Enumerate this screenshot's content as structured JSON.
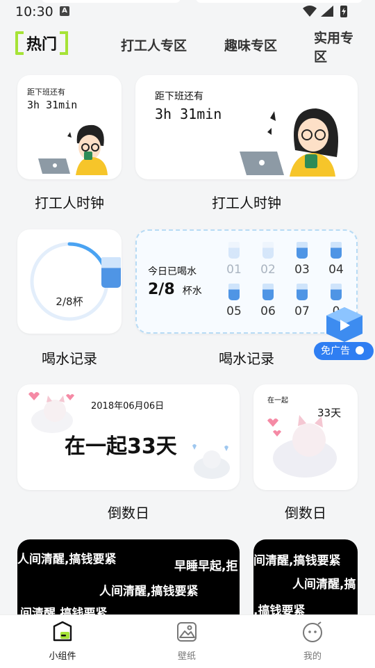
{
  "status": {
    "time": "10:30",
    "notif": "A"
  },
  "tabs": {
    "active": "热门",
    "items": [
      "打工人专区",
      "趣味专区",
      "实用专"
    ],
    "item3_line2": "区"
  },
  "work_clock": {
    "small": {
      "line1": "距下班还有",
      "line2": "3h 31min"
    },
    "large": {
      "line1": "距下班还有",
      "line2": "3h 31min"
    },
    "label1": "打工人时钟",
    "label2": "打工人时钟"
  },
  "water": {
    "small": {
      "value": "2/8杯",
      "progress": 0.25
    },
    "large": {
      "title": "今日已喝水",
      "count": "2/8",
      "unit": "杯水",
      "cups": [
        {
          "num": "01",
          "done": false
        },
        {
          "num": "02",
          "done": false
        },
        {
          "num": "03",
          "done": true
        },
        {
          "num": "04",
          "done": true
        },
        {
          "num": "05",
          "done": true
        },
        {
          "num": "06",
          "done": true
        },
        {
          "num": "07",
          "done": true
        },
        {
          "num": "0",
          "done": true
        }
      ]
    },
    "label1": "喝水记录",
    "label2": "喝水记录"
  },
  "ad": {
    "label": "免广告"
  },
  "countdown": {
    "large": {
      "date": "2018年06月06日",
      "text": "在一起33天"
    },
    "small": {
      "top": "在一起",
      "days": "33天"
    },
    "label1": "倒数日",
    "label2": "倒数日"
  },
  "quotes": {
    "left": [
      "人间清醒,搞钱要紧",
      "早睡早起,拒",
      "人间清醒,搞钱要紧",
      "间清醒,搞钱要紧"
    ],
    "right": [
      "间清醒,搞钱要紧",
      "人间清醒,搞",
      ",搞钱要紧"
    ]
  },
  "nav": {
    "widgets": "小组件",
    "wallpaper": "壁纸",
    "mine": "我的"
  }
}
